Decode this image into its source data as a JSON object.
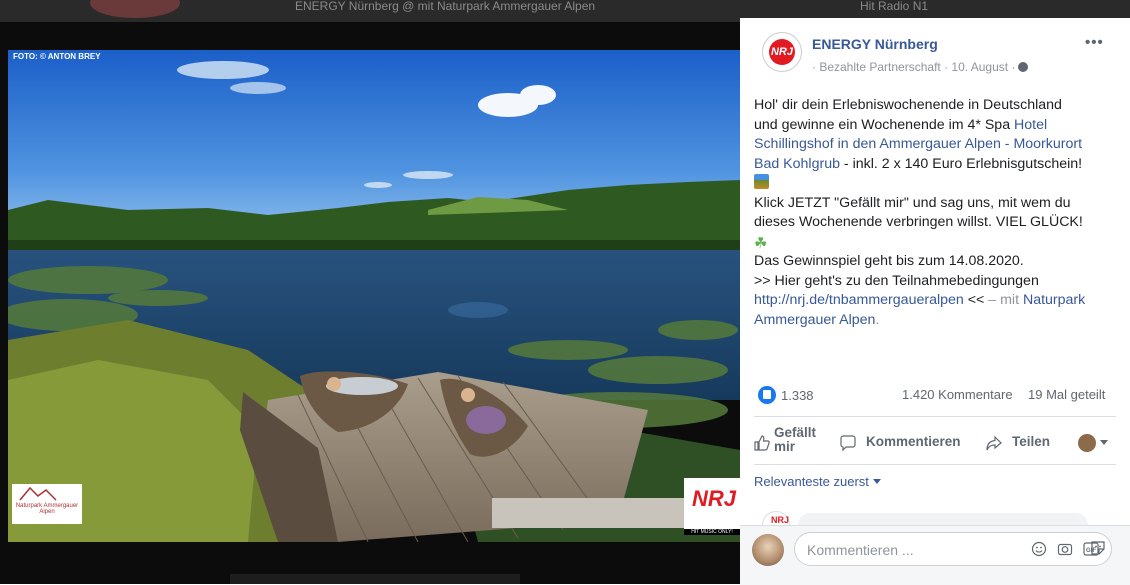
{
  "background_feed": {
    "ghost_text": "ENERGY Nürnberg @ mit Naturpark Ammergauer Alpen",
    "ghost_text_right": "Hit Radio N1"
  },
  "photo": {
    "credit": "FOTO: © ANTON BREY",
    "naturpark_logo_text": "Naturpark Ammergauer Alpen",
    "nrj_logo_text": "NRJ",
    "nrj_tagline": "HIT MUSIC ONLY!"
  },
  "post": {
    "page_name": "ENERGY Nürnberg",
    "page_avatar_text": "NRJ",
    "meta": "· Bezahlte Partnerschaft · 10. August ·",
    "more_label": "•••",
    "lines": {
      "l1": "Hol' dir dein Erlebniswochenende in Deutschland",
      "l2a": "und gewinne ein Wochenende im 4* Spa ",
      "l2b": "Hotel",
      "l3": "Schillingshof in den Ammergauer Alpen - Moorkurort",
      "l4a": "Bad Kohlgrub",
      "l4b": " - inkl. 2 x 140 Euro Erlebnisgutschein!",
      "l5": "Klick JETZT \"Gefällt mir\" und sag uns, mit wem du",
      "l6": "dieses Wochenende verbringen willst. VIEL GLÜCK!",
      "l7": "Das Gewinnspiel geht bis zum 14.08.2020.",
      "l8": ">> Hier geht's zu den Teilnahmebedingungen",
      "l9a": "http://nrj.de/tnbammergaueralpen",
      "l9b": " << ",
      "l9c": "– mit ",
      "l9d": "Naturpark",
      "l10a": "Ammergauer Alpen",
      "l10b": "."
    },
    "emoji": {
      "mountain": "mountain-emoji",
      "clover": "☘"
    }
  },
  "engagement": {
    "likes": "1.338",
    "comments": "1.420 Kommentare",
    "shares": "19 Mal geteilt"
  },
  "actions": {
    "like_line1": "Gefällt",
    "like_line2": "mir",
    "comment": "Kommentieren",
    "share": "Teilen"
  },
  "comments": {
    "sort_label": "Relevanteste zuerst",
    "peek_avatar_text": "NRJ",
    "compose_placeholder": "Kommentieren ..."
  },
  "colors": {
    "link": "#385898",
    "like_blue": "#1877f2",
    "muted": "#90949c",
    "nrj_red": "#e21a22"
  }
}
